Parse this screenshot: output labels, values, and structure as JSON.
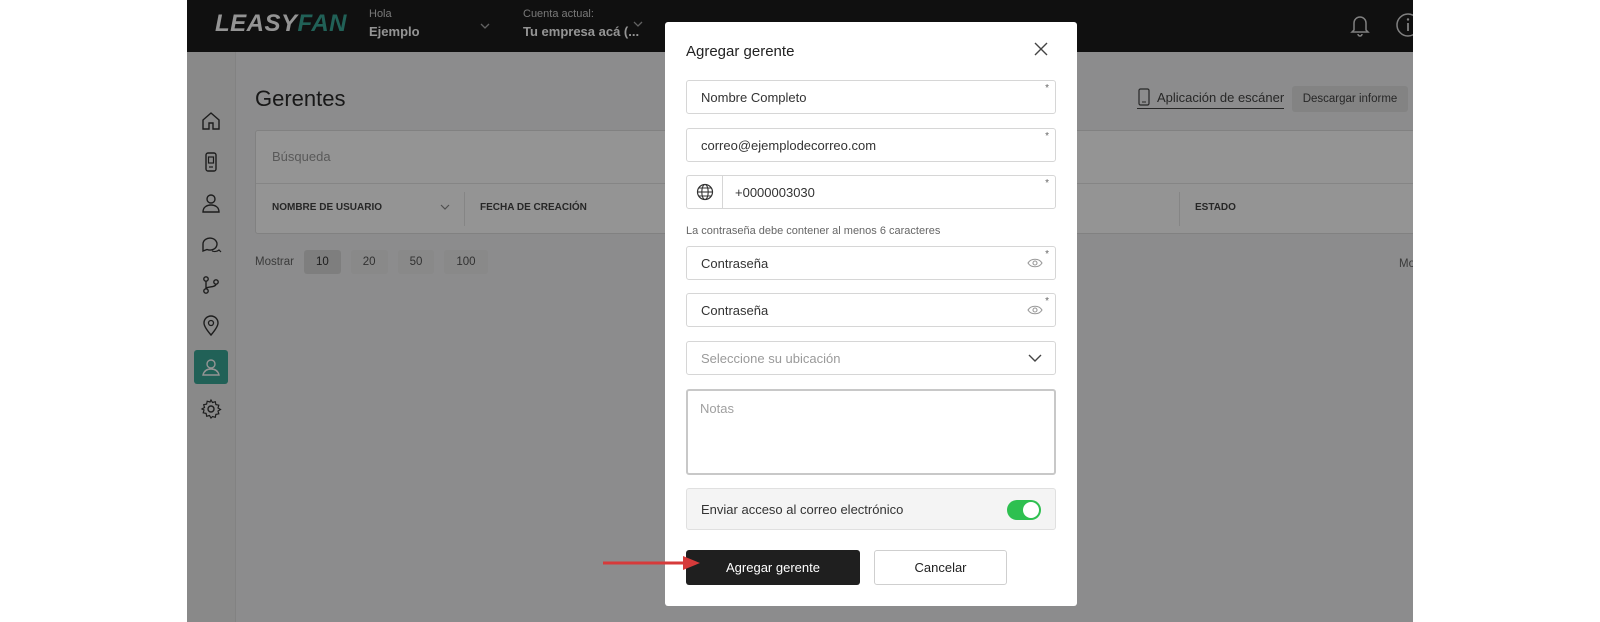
{
  "header": {
    "logo_part1": "LEASY",
    "logo_part2": "FAN",
    "greeting_small": "Hola",
    "greeting_name": "Ejemplo",
    "account_small": "Cuenta actual:",
    "account_name": "Tu empresa acá (..."
  },
  "sidebar": {
    "items": [
      {
        "icon": "home-icon"
      },
      {
        "icon": "device-icon"
      },
      {
        "icon": "users-icon"
      },
      {
        "icon": "chat-icon"
      },
      {
        "icon": "branch-icon"
      },
      {
        "icon": "location-pin-icon"
      },
      {
        "icon": "user-icon",
        "active": true
      },
      {
        "icon": "gear-icon"
      }
    ]
  },
  "page": {
    "title": "Gerentes",
    "scanner_label": "Aplicación de escáner",
    "download_label": "Descargar informe",
    "search_placeholder": "Búsqueda",
    "columns": [
      "NOMBRE DE USUARIO",
      "FECHA DE CREACIÓN",
      "ESTADO"
    ],
    "show_label": "Mostrar",
    "page_sizes": [
      "10",
      "20",
      "50",
      "100"
    ],
    "active_page_size": "10",
    "right_cut_text": "Mo"
  },
  "modal": {
    "title": "Agregar gerente",
    "full_name_value": "Nombre Completo",
    "email_value": "correo@ejemplodecorreo.com",
    "phone_value": "+0000003030",
    "required_mark": "*",
    "password_hint": "La contraseña debe contener al menos 6 caracteres",
    "password_value": "Contraseña",
    "password_confirm_value": "Contraseña",
    "location_placeholder": "Seleccione su ubicación",
    "notes_placeholder": "Notas",
    "send_access_label": "Enviar acceso al correo electrónico",
    "send_access_enabled": true,
    "submit_label": "Agregar gerente",
    "cancel_label": "Cancelar"
  },
  "colors": {
    "accent": "#3aa796",
    "topbar": "#1c1c1c",
    "toggle_on": "#2ec050",
    "arrow": "#d63a3a"
  }
}
